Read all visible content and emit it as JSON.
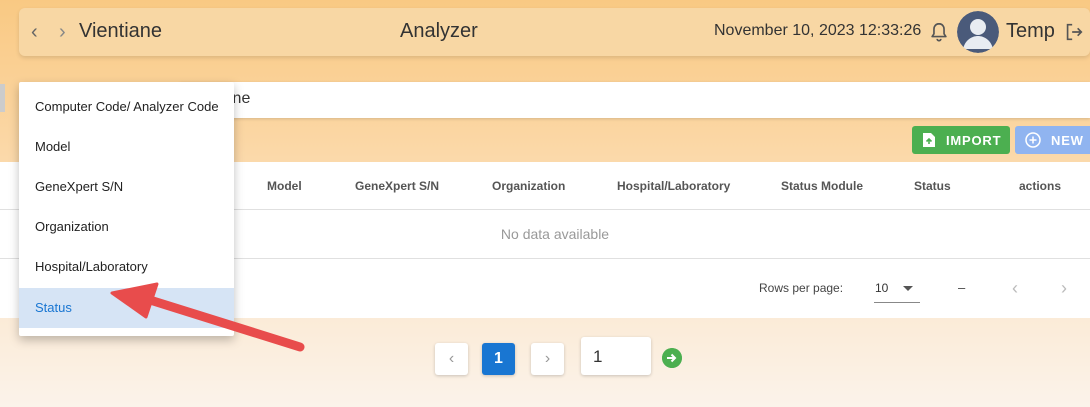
{
  "topbar": {
    "back": "‹",
    "forward": "›",
    "city": "Vientiane",
    "title": "Analyzer",
    "datetime": "November 10, 2023 12:33:26",
    "user": "Temp"
  },
  "search": {
    "visible_text": "ine"
  },
  "buttons": {
    "import": "IMPORT",
    "new": "NEW"
  },
  "table": {
    "columns": [
      "Model",
      "GeneXpert S/N",
      "Organization",
      "Hospital/Laboratory",
      "Status Module",
      "Status",
      "actions"
    ],
    "empty_text": "No data available",
    "rows_per_page_label": "Rows per page:",
    "rows_per_page_value": "10",
    "range_text": "–"
  },
  "pager": {
    "prev": "‹",
    "current": "1",
    "next": "›",
    "goto_value": "1"
  },
  "dropdown": {
    "items": [
      "Computer Code/ Analyzer Code",
      "Model",
      "GeneXpert S/N",
      "Organization",
      "Hospital/Laboratory",
      "Status"
    ],
    "selected": "Status"
  },
  "colors": {
    "accent": "#1976d2",
    "import": "#4caf50",
    "new": "#90b4f0",
    "arrow": "#e84c4c"
  }
}
